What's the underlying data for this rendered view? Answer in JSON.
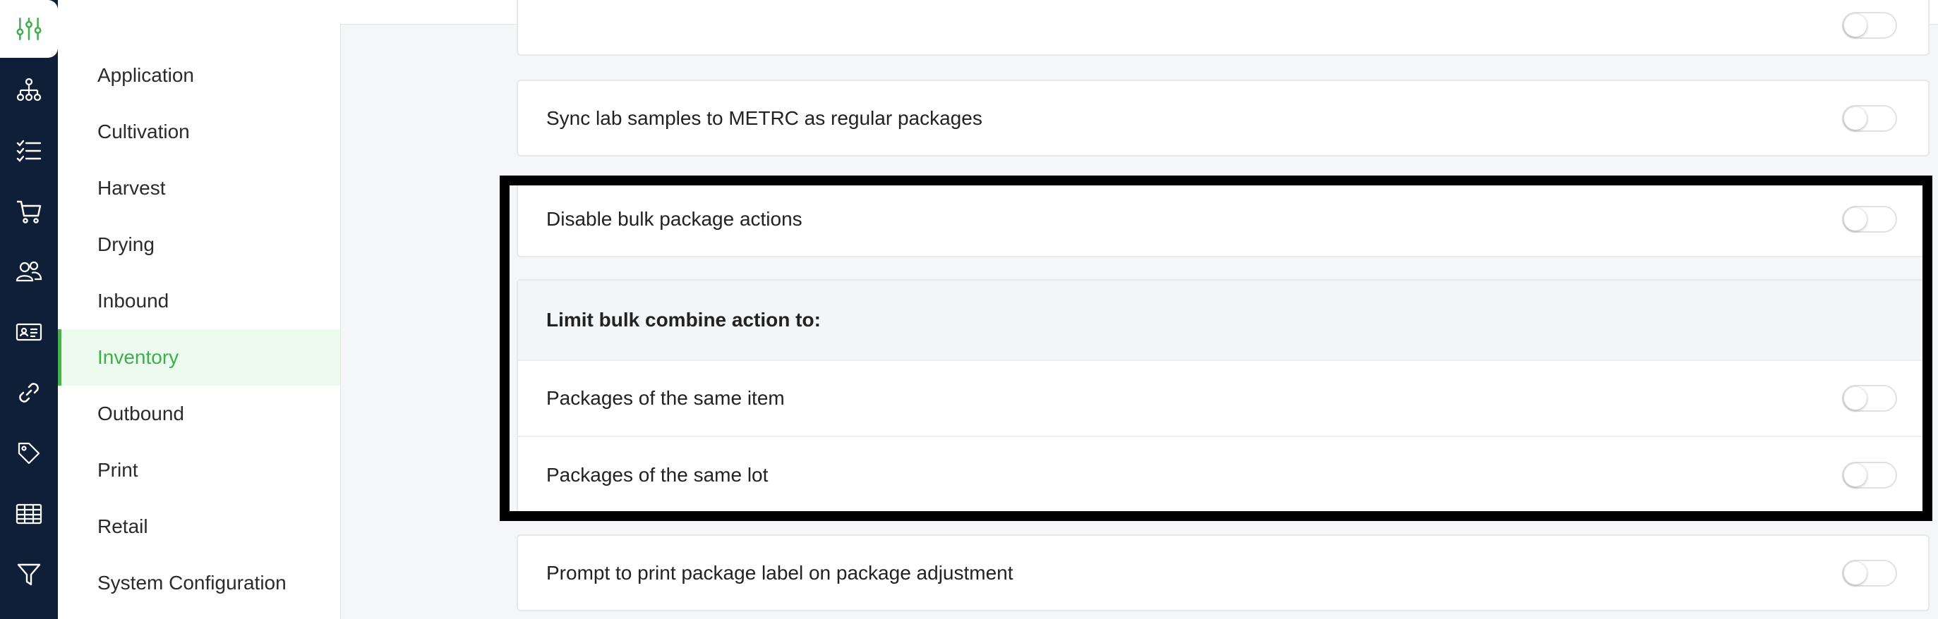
{
  "sidebar_rail": {
    "icons": [
      "sliders-icon",
      "org-chart-icon",
      "checklist-icon",
      "cart-icon",
      "users-icon",
      "id-card-icon",
      "link-icon",
      "tags-icon",
      "table-icon",
      "filter-icon"
    ]
  },
  "submenu": {
    "items": [
      {
        "label": "Application"
      },
      {
        "label": "Cultivation"
      },
      {
        "label": "Harvest"
      },
      {
        "label": "Drying"
      },
      {
        "label": "Inbound"
      },
      {
        "label": "Inventory",
        "active": true
      },
      {
        "label": "Outbound"
      },
      {
        "label": "Print"
      },
      {
        "label": "Retail"
      },
      {
        "label": "System Configuration"
      }
    ]
  },
  "settings": {
    "sync_lab_samples": {
      "label": "Sync lab samples to METRC as regular packages",
      "enabled": false
    },
    "disable_bulk": {
      "label": "Disable bulk package actions",
      "enabled": false
    },
    "limit_header": "Limit bulk combine action to:",
    "same_item": {
      "label": "Packages of the same item",
      "enabled": false
    },
    "same_lot": {
      "label": "Packages of the same lot",
      "enabled": false
    },
    "prompt_print": {
      "label": "Prompt to print package label on package adjustment",
      "enabled": false
    }
  },
  "colors": {
    "rail_bg": "#0f1f38",
    "accent": "#4caf50",
    "active_bg": "#ecfbee",
    "highlight": "#000000"
  }
}
